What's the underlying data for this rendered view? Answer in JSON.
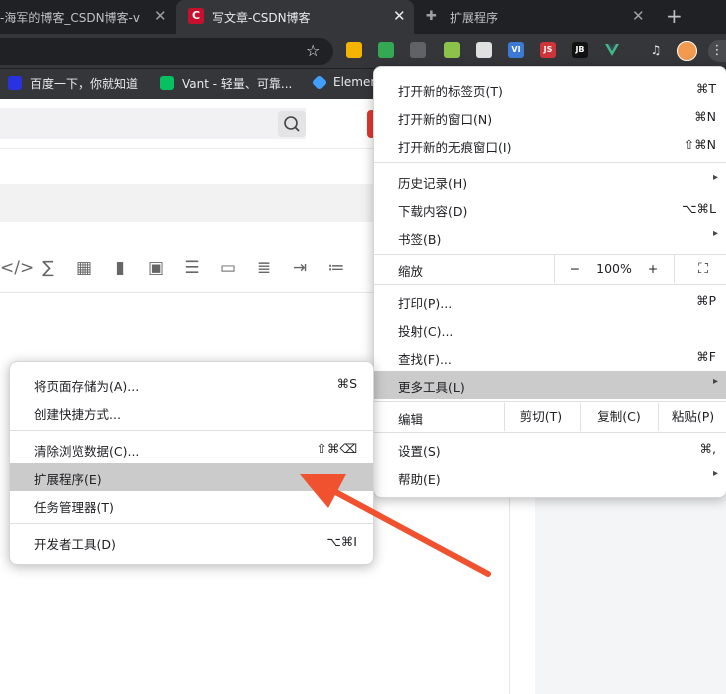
{
  "browser": {
    "tabs": [
      {
        "title": "-海军的博客_CSDN博客-v",
        "active": false
      },
      {
        "title": "写文章-CSDN博客",
        "active": true,
        "favicon_text": "C"
      },
      {
        "title": "扩展程序",
        "active": false
      }
    ],
    "toolbar": {
      "extensions": [
        {
          "name": "extension-1",
          "color": "#f4b400"
        },
        {
          "name": "extension-2",
          "color": "#34a853"
        },
        {
          "name": "extension-3",
          "color": "#5f6368"
        },
        {
          "name": "extension-4",
          "color": "#8bc34a"
        },
        {
          "name": "extension-5",
          "color": "#e0e0e0"
        },
        {
          "name": "extension-vi",
          "color": "#3d7ad6",
          "text": "VI"
        },
        {
          "name": "extension-js",
          "color": "#d0343b",
          "text": "JS"
        },
        {
          "name": "extension-jb",
          "color": "#111111",
          "text": "JB"
        },
        {
          "name": "extension-vue",
          "color": "#41b883"
        },
        {
          "name": "extension-media",
          "color": "#35363a"
        }
      ]
    },
    "bookmarks": [
      {
        "label": "百度一下，你就知道",
        "color": "#2932e1"
      },
      {
        "label": "Vant - 轻量、可靠...",
        "color": "#07c160"
      },
      {
        "label": "Elemen",
        "color": "#409eff"
      }
    ]
  },
  "chrome_menu": {
    "items": [
      {
        "label": "打开新的标签页(T)",
        "shortcut": "⌘T"
      },
      {
        "label": "打开新的窗口(N)",
        "shortcut": "⌘N"
      },
      {
        "label": "打开新的无痕窗口(I)",
        "shortcut": "⇧⌘N"
      },
      {
        "label": "历史记录(H)",
        "shortcut": "▸"
      },
      {
        "label": "下载内容(D)",
        "shortcut": "⌥⌘L"
      },
      {
        "label": "书签(B)",
        "shortcut": "▸"
      },
      {
        "label": "打印(P)...",
        "shortcut": "⌘P"
      },
      {
        "label": "投射(C)...",
        "shortcut": ""
      },
      {
        "label": "查找(F)...",
        "shortcut": "⌘F"
      },
      {
        "label": "更多工具(L)",
        "shortcut": "▸",
        "highlighted": true
      },
      {
        "label": "设置(S)",
        "shortcut": "⌘,"
      },
      {
        "label": "帮助(E)",
        "shortcut": "▸"
      }
    ],
    "zoom": {
      "label": "缩放",
      "minus": "−",
      "value": "100%",
      "plus": "+",
      "fullscreen": "⛶"
    },
    "edit": {
      "label": "编辑",
      "cut": "剪切(T)",
      "copy": "复制(C)",
      "paste": "粘贴(P)"
    }
  },
  "more_tools_menu": {
    "items": [
      {
        "label": "将页面存储为(A)...",
        "shortcut": "⌘S"
      },
      {
        "label": "创建快捷方式...",
        "shortcut": ""
      },
      {
        "label": "清除浏览数据(C)...",
        "shortcut": "⇧⌘⌫"
      },
      {
        "label": "扩展程序(E)",
        "shortcut": "",
        "highlighted": true
      },
      {
        "label": "任务管理器(T)",
        "shortcut": ""
      },
      {
        "label": "开发者工具(D)",
        "shortcut": "⌥⌘I"
      }
    ]
  },
  "editor_toolbar": {
    "icons": [
      "</>",
      "∑",
      "▦",
      "▮",
      "▣",
      "☰",
      "▭",
      "≣",
      "⇥",
      "≔"
    ]
  },
  "annotation": {
    "arrow_color": "#f0522f"
  }
}
